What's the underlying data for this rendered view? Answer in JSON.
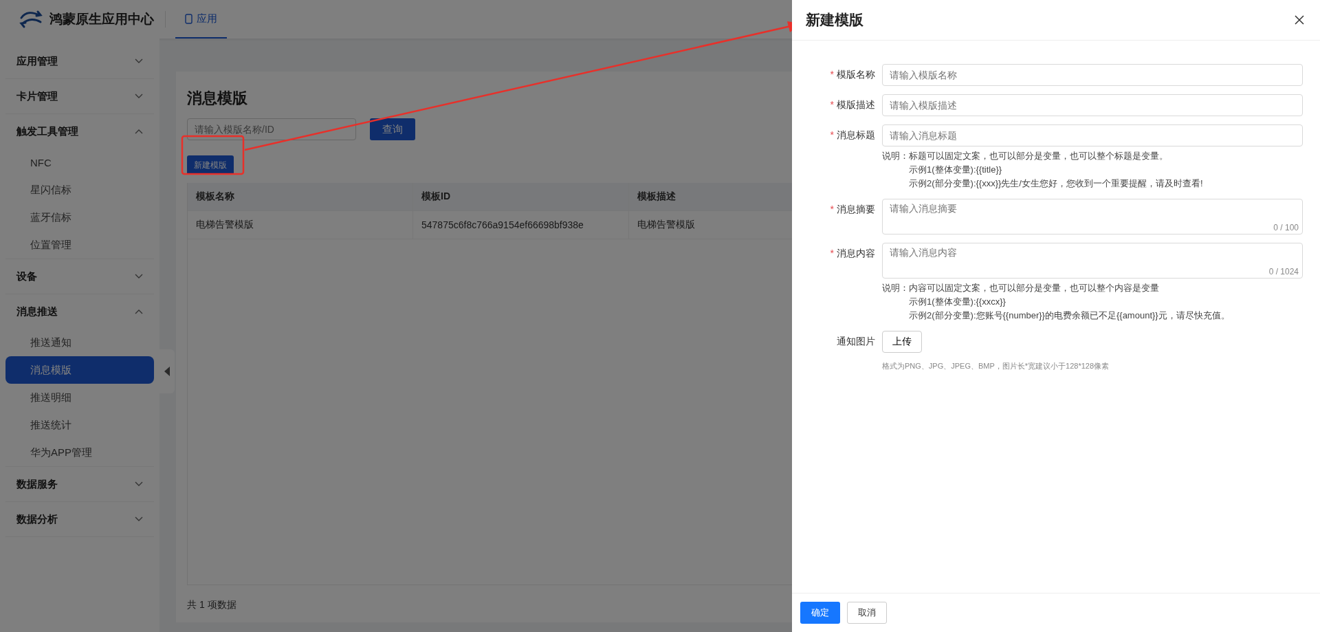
{
  "header": {
    "app_name": "鸿蒙原生应用中心",
    "tabs": [
      {
        "label": "应用",
        "selected": true
      }
    ]
  },
  "sidebar": {
    "groups": [
      {
        "label": "应用管理",
        "expanded": false
      },
      {
        "label": "卡片管理",
        "expanded": false
      },
      {
        "label": "触发工具管理",
        "expanded": true,
        "children": [
          {
            "label": "NFC",
            "selected": false
          },
          {
            "label": "星闪信标",
            "selected": false
          },
          {
            "label": "蓝牙信标",
            "selected": false
          },
          {
            "label": "位置管理",
            "selected": false
          }
        ]
      },
      {
        "label": "设备",
        "expanded": false
      },
      {
        "label": "消息推送",
        "expanded": true,
        "children": [
          {
            "label": "推送通知",
            "selected": false
          },
          {
            "label": "消息模版",
            "selected": true
          },
          {
            "label": "推送明细",
            "selected": false
          },
          {
            "label": "推送统计",
            "selected": false
          },
          {
            "label": "华为APP管理",
            "selected": false
          }
        ]
      },
      {
        "label": "数据服务",
        "expanded": false
      },
      {
        "label": "数据分析",
        "expanded": false
      }
    ]
  },
  "page": {
    "title": "消息模版",
    "search": {
      "placeholder": "请输入模版名称/ID"
    },
    "search_button": "查询",
    "new_button": "新建模版",
    "table": {
      "columns": [
        "模板名称",
        "模板ID",
        "模板描述"
      ],
      "rows": [
        [
          "电梯告警模版",
          "547875c6f8c766a9154ef66698bf938e",
          "电梯告警模版"
        ]
      ]
    },
    "total": "共 1 项数据"
  },
  "drawer": {
    "title": "新建模版",
    "fields": [
      {
        "kind": "input",
        "label": "模版名称",
        "required_mark": "*",
        "placeholder": "请输入模版名称"
      },
      {
        "kind": "input",
        "label": "模版描述",
        "required_mark": "*",
        "placeholder": "请输入模版描述"
      },
      {
        "kind": "input",
        "label": "消息标题",
        "required_mark": "*",
        "placeholder": "请输入消息标题",
        "note": {
          "prefix": "说明：",
          "lines": [
            "标题可以固定文案，也可以部分是变量，也可以整个标题是变量。",
            "示例1(整体变量):{{title}}",
            "示例2(部分变量):{{xxx}}先生/女生您好，您收到一个重要提醒，请及时查看!"
          ]
        }
      },
      {
        "kind": "textarea",
        "label": "消息摘要",
        "required_mark": "*",
        "placeholder": "请输入消息摘要",
        "counter": "0 / 100"
      },
      {
        "kind": "textarea",
        "label": "消息内容",
        "required_mark": "*",
        "placeholder": "请输入消息内容",
        "counter": "0 / 1024",
        "note": {
          "prefix": "说明：",
          "lines": [
            "内容可以固定文案，也可以部分是变量，也可以整个内容是变量",
            "示例1(整体变量):{{xxcx}}",
            "示例2(部分变量):您账号{{number}}的电费余额已不足{{amount}}元，请尽快充值。"
          ]
        }
      },
      {
        "kind": "upload",
        "label": "通知图片",
        "button": "上传",
        "hint": "格式为PNG、JPG、JPEG、BMP，图片长*宽建议小于128*128像素"
      }
    ],
    "ok_button": "确定",
    "cancel_button": "取消"
  }
}
